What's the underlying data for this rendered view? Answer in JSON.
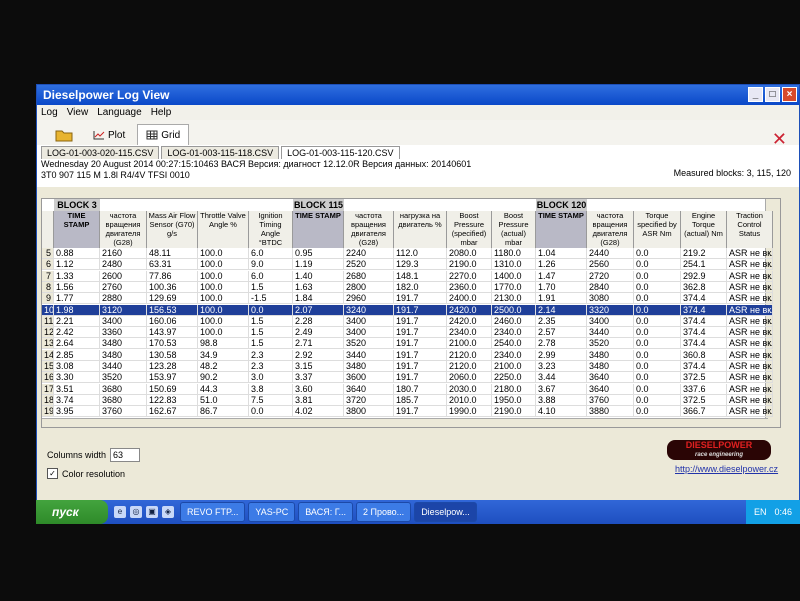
{
  "window": {
    "title": "Dieselpower Log View",
    "controls": {
      "minimize": "_",
      "maximize": "□",
      "close": "×"
    }
  },
  "menu": [
    "Log",
    "View",
    "Language",
    "Help"
  ],
  "toolbar": {
    "plot_label": "Plot",
    "grid_label": "Grid"
  },
  "file_tabs": [
    "LOG-01-003-020-115.CSV",
    "LOG-01-003-115-118.CSV",
    "LOG-01-003-115-120.CSV"
  ],
  "info": {
    "line1": "Wednesday 20 August 2014 00:27:15:10463 ВАСЯ Версия: диагност 12.12.0R Версия данных: 20140601",
    "line2": "3T0 907 115 M   1.8l R4/4V TFSI      0010",
    "measured": "Measured blocks: 3, 115, 120"
  },
  "blocks": [
    "BLOCK 3",
    "BLOCK 115",
    "BLOCK 120"
  ],
  "columns": [
    "TIME STAMP",
    "частота вращения двигателя (G28)",
    "Mass Air Flow Sensor (G70) g/s",
    "Throttle Valve Angle %",
    "Ignition Timing Angle °BTDC",
    "TIME STAMP",
    "частота вращения двигателя (G28)",
    "нагрузка на двигатель %",
    "Boost Pressure (specified) mbar",
    "Boost Pressure (actual) mbar",
    "TIME STAMP",
    "частота вращения двигателя (G28)",
    "Torque specified by ASR Nm",
    "Engine Torque (actual) Nm",
    "Traction Control Status"
  ],
  "rows": [
    {
      "n": "5",
      "c": [
        "0.88",
        "2160",
        "48.11",
        "100.0",
        "6.0",
        "0.95",
        "2240",
        "112.0",
        "2080.0",
        "1180.0",
        "1.04",
        "2440",
        "0.0",
        "219.2",
        "ASR не вкл"
      ]
    },
    {
      "n": "6",
      "c": [
        "1.12",
        "2480",
        "63.31",
        "100.0",
        "9.0",
        "1.19",
        "2520",
        "129.3",
        "2190.0",
        "1310.0",
        "1.26",
        "2560",
        "0.0",
        "254.1",
        "ASR не вкл"
      ]
    },
    {
      "n": "7",
      "c": [
        "1.33",
        "2600",
        "77.86",
        "100.0",
        "6.0",
        "1.40",
        "2680",
        "148.1",
        "2270.0",
        "1400.0",
        "1.47",
        "2720",
        "0.0",
        "292.9",
        "ASR не вкл"
      ]
    },
    {
      "n": "8",
      "c": [
        "1.56",
        "2760",
        "100.36",
        "100.0",
        "1.5",
        "1.63",
        "2800",
        "182.0",
        "2360.0",
        "1770.0",
        "1.70",
        "2840",
        "0.0",
        "362.8",
        "ASR не вкл"
      ]
    },
    {
      "n": "9",
      "c": [
        "1.77",
        "2880",
        "129.69",
        "100.0",
        "-1.5",
        "1.84",
        "2960",
        "191.7",
        "2400.0",
        "2130.0",
        "1.91",
        "3080",
        "0.0",
        "374.4",
        "ASR не вкл"
      ]
    },
    {
      "n": "10",
      "c": [
        "1.98",
        "3120",
        "156.53",
        "100.0",
        "0.0",
        "2.07",
        "3240",
        "191.7",
        "2420.0",
        "2500.0",
        "2.14",
        "3320",
        "0.0",
        "374.4",
        "ASR не вкл"
      ],
      "selected": true
    },
    {
      "n": "11",
      "c": [
        "2.21",
        "3400",
        "160.06",
        "100.0",
        "1.5",
        "2.28",
        "3400",
        "191.7",
        "2420.0",
        "2460.0",
        "2.35",
        "3400",
        "0.0",
        "374.4",
        "ASR не вкл"
      ]
    },
    {
      "n": "12",
      "c": [
        "2.42",
        "3360",
        "143.97",
        "100.0",
        "1.5",
        "2.49",
        "3400",
        "191.7",
        "2340.0",
        "2340.0",
        "2.57",
        "3440",
        "0.0",
        "374.4",
        "ASR не вкл"
      ]
    },
    {
      "n": "13",
      "c": [
        "2.64",
        "3480",
        "170.53",
        "98.8",
        "1.5",
        "2.71",
        "3520",
        "191.7",
        "2100.0",
        "2540.0",
        "2.78",
        "3520",
        "0.0",
        "374.4",
        "ASR не вкл"
      ]
    },
    {
      "n": "14",
      "c": [
        "2.85",
        "3480",
        "130.58",
        "34.9",
        "2.3",
        "2.92",
        "3440",
        "191.7",
        "2120.0",
        "2340.0",
        "2.99",
        "3480",
        "0.0",
        "360.8",
        "ASR не вкл"
      ]
    },
    {
      "n": "15",
      "c": [
        "3.08",
        "3440",
        "123.28",
        "48.2",
        "2.3",
        "3.15",
        "3480",
        "191.7",
        "2120.0",
        "2100.0",
        "3.23",
        "3480",
        "0.0",
        "374.4",
        "ASR не вкл"
      ]
    },
    {
      "n": "16",
      "c": [
        "3.30",
        "3520",
        "153.97",
        "90.2",
        "3.0",
        "3.37",
        "3600",
        "191.7",
        "2060.0",
        "2250.0",
        "3.44",
        "3640",
        "0.0",
        "372.5",
        "ASR не вкл"
      ]
    },
    {
      "n": "17",
      "c": [
        "3.51",
        "3680",
        "150.69",
        "44.3",
        "3.8",
        "3.60",
        "3640",
        "180.7",
        "2030.0",
        "2180.0",
        "3.67",
        "3640",
        "0.0",
        "337.6",
        "ASR не вкл"
      ]
    },
    {
      "n": "18",
      "c": [
        "3.74",
        "3680",
        "122.83",
        "51.0",
        "7.5",
        "3.81",
        "3720",
        "185.7",
        "2010.0",
        "1950.0",
        "3.88",
        "3760",
        "0.0",
        "372.5",
        "ASR не вкл"
      ]
    },
    {
      "n": "19",
      "c": [
        "3.95",
        "3760",
        "162.67",
        "86.7",
        "0.0",
        "4.02",
        "3800",
        "191.7",
        "1990.0",
        "2190.0",
        "4.10",
        "3880",
        "0.0",
        "366.7",
        "ASR не вкл"
      ]
    }
  ],
  "bottom": {
    "columns_width_label": "Columns width",
    "columns_width_value": "63",
    "color_resolution_label": "Color resolution",
    "color_resolution_checked": "✓",
    "logo_text": "DIESELPOWER",
    "logo_sub": "race engineering",
    "site": "http://www.dieselpower.cz"
  },
  "taskbar": {
    "start": "пуск",
    "tasks": [
      "REVO FTP...",
      "YAS-PC",
      "ВАСЯ: Г...",
      "2 Прово...",
      "Dieselpow..."
    ],
    "lang": "EN",
    "time": "0:46"
  }
}
